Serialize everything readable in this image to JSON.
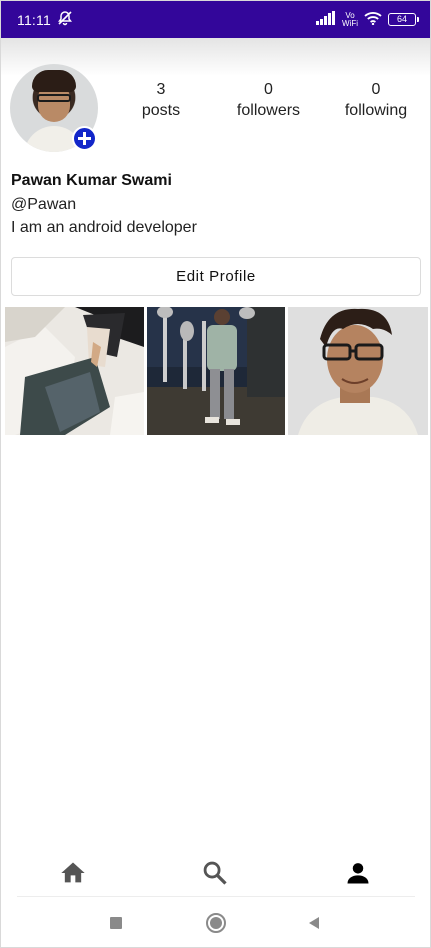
{
  "status_bar": {
    "time": "11:11",
    "network_label_top": "Vo",
    "network_label_bottom": "WiFi",
    "battery": "64",
    "icons": [
      "mute-icon",
      "signal-icon",
      "wifi-icon",
      "battery-icon"
    ],
    "background": "#33069a"
  },
  "profile": {
    "avatar_icon": "avatar-photo",
    "add_icon": "add-circle-icon",
    "stats": [
      {
        "count": "3",
        "label": "posts"
      },
      {
        "count": "0",
        "label": "followers"
      },
      {
        "count": "0",
        "label": "following"
      }
    ],
    "name": "Pawan Kumar Swami",
    "handle": "@Pawan",
    "bio": "I am an android developer",
    "edit_button": "Edit Profile"
  },
  "posts": [
    {
      "icon": "anime-illustration-photo"
    },
    {
      "icon": "person-standing-photo"
    },
    {
      "icon": "person-portrait-photo"
    }
  ],
  "bottom_nav": {
    "items": [
      {
        "icon": "home-icon"
      },
      {
        "icon": "search-icon"
      },
      {
        "icon": "profile-icon"
      }
    ],
    "active_color": "#000000",
    "inactive_color": "#555555"
  },
  "system_nav": {
    "icons": [
      "recents-icon",
      "home-circle-icon",
      "back-icon"
    ]
  }
}
